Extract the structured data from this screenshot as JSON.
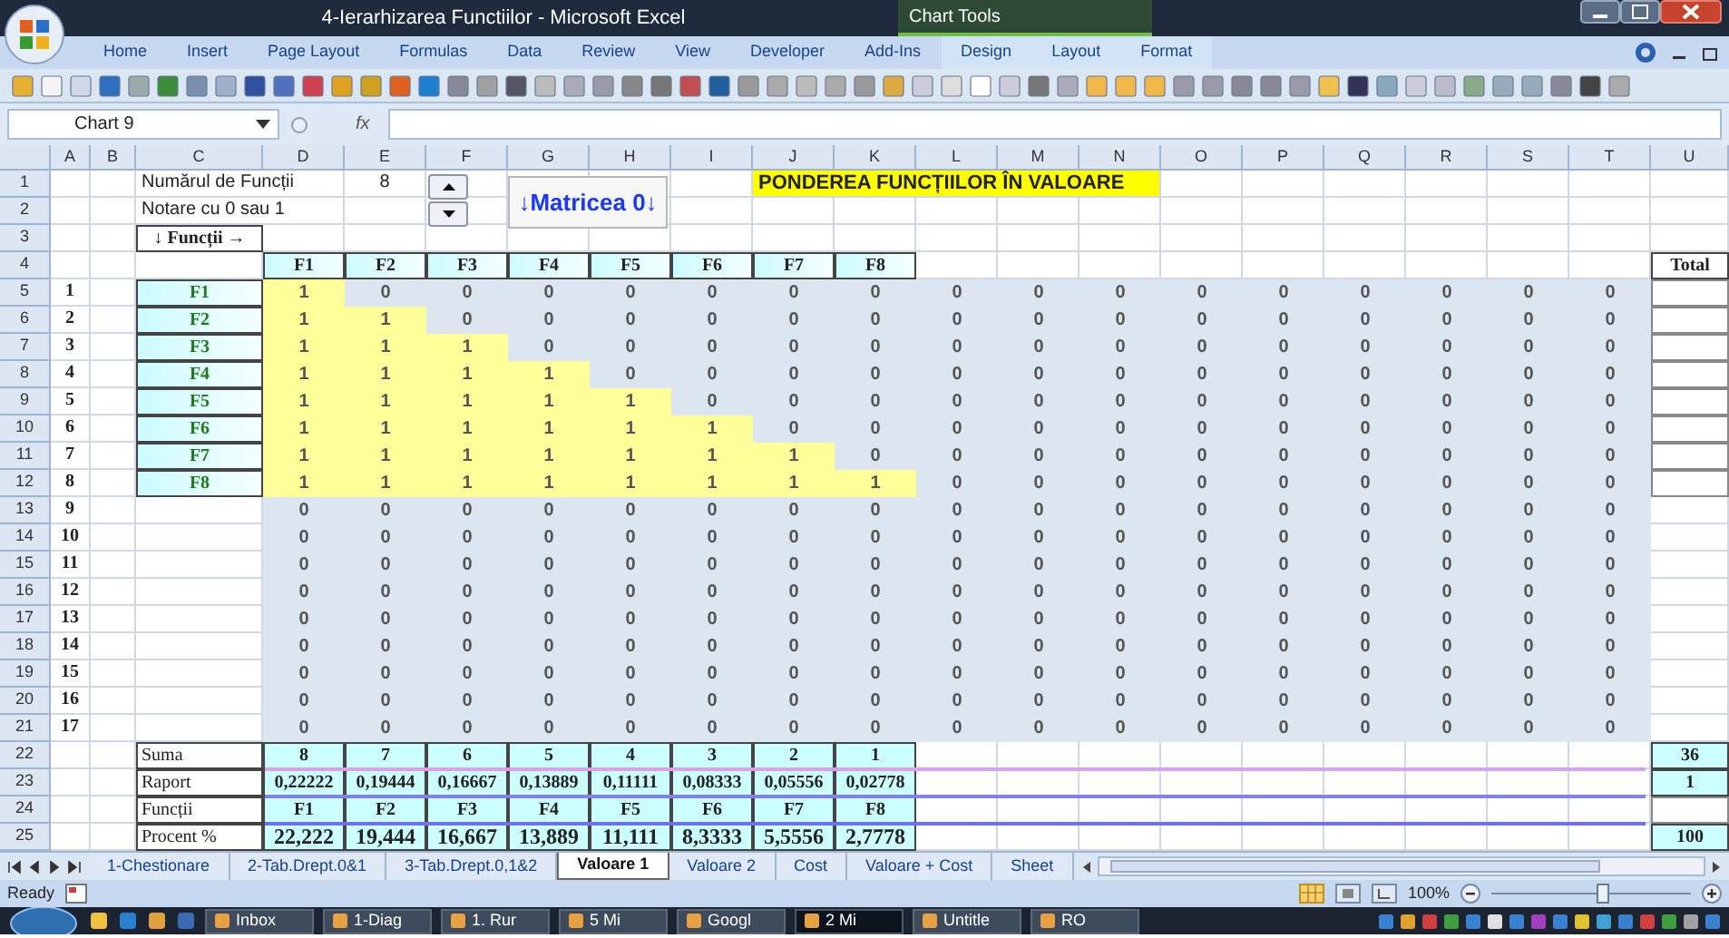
{
  "window": {
    "title": "4-Ierarhizarea Functiilor - Microsoft Excel",
    "context_label": "Chart Tools"
  },
  "ribbon_tabs": [
    {
      "label": "Home",
      "contextual": false
    },
    {
      "label": "Insert",
      "contextual": false
    },
    {
      "label": "Page Layout",
      "contextual": false
    },
    {
      "label": "Formulas",
      "contextual": false
    },
    {
      "label": "Data",
      "contextual": false
    },
    {
      "label": "Review",
      "contextual": false
    },
    {
      "label": "View",
      "contextual": false
    },
    {
      "label": "Developer",
      "contextual": false
    },
    {
      "label": "Add-Ins",
      "contextual": false
    },
    {
      "label": "Design",
      "contextual": true
    },
    {
      "label": "Layout",
      "contextual": true
    },
    {
      "label": "Format",
      "contextual": true
    }
  ],
  "formula_bar": {
    "name_box": "Chart 9",
    "function_label": "fx"
  },
  "columns": [
    "A",
    "B",
    "C",
    "D",
    "E",
    "F",
    "G",
    "H",
    "I",
    "J",
    "K",
    "L",
    "M",
    "N",
    "O",
    "P",
    "Q",
    "R",
    "S",
    "T",
    "U"
  ],
  "row_numbers": [
    "1",
    "2",
    "3",
    "4",
    "5",
    "6",
    "7",
    "8",
    "9",
    "10",
    "11",
    "12",
    "13",
    "14",
    "15",
    "16",
    "17",
    "18",
    "19",
    "20",
    "21",
    "22",
    "23",
    "24",
    "25"
  ],
  "header_block": {
    "count_label": "Numărul de Funcții",
    "count_value": "8",
    "note": "Notare cu 0 sau 1",
    "axis_label": "↓ Funcții →",
    "heading": "PONDEREA FUNCȚIILOR ÎN VALOARE"
  },
  "matrix_button": "↓Matricea 0↓",
  "matrix": {
    "column_labels": [
      "F1",
      "F2",
      "F3",
      "F4",
      "F5",
      "F6",
      "F7",
      "F8"
    ],
    "total_label": "Total",
    "rows": [
      {
        "number": "1",
        "label": "F1",
        "values": [
          "1",
          "0",
          "0",
          "0",
          "0",
          "0",
          "0",
          "0",
          "0",
          "0",
          "0",
          "0",
          "0",
          "0",
          "0",
          "0",
          "0"
        ],
        "highlighted": [
          true,
          false,
          false,
          false,
          false,
          false,
          false,
          false,
          false,
          false,
          false,
          false,
          false,
          false,
          false,
          false,
          false
        ]
      },
      {
        "number": "2",
        "label": "F2",
        "values": [
          "1",
          "1",
          "0",
          "0",
          "0",
          "0",
          "0",
          "0",
          "0",
          "0",
          "0",
          "0",
          "0",
          "0",
          "0",
          "0",
          "0"
        ],
        "highlighted": [
          true,
          true,
          false,
          false,
          false,
          false,
          false,
          false,
          false,
          false,
          false,
          false,
          false,
          false,
          false,
          false,
          false
        ]
      },
      {
        "number": "3",
        "label": "F3",
        "values": [
          "1",
          "1",
          "1",
          "0",
          "0",
          "0",
          "0",
          "0",
          "0",
          "0",
          "0",
          "0",
          "0",
          "0",
          "0",
          "0",
          "0"
        ],
        "highlighted": [
          true,
          true,
          true,
          false,
          false,
          false,
          false,
          false,
          false,
          false,
          false,
          false,
          false,
          false,
          false,
          false,
          false
        ]
      },
      {
        "number": "4",
        "label": "F4",
        "values": [
          "1",
          "1",
          "1",
          "1",
          "0",
          "0",
          "0",
          "0",
          "0",
          "0",
          "0",
          "0",
          "0",
          "0",
          "0",
          "0",
          "0"
        ],
        "highlighted": [
          true,
          true,
          true,
          true,
          false,
          false,
          false,
          false,
          false,
          false,
          false,
          false,
          false,
          false,
          false,
          false,
          false
        ]
      },
      {
        "number": "5",
        "label": "F5",
        "values": [
          "1",
          "1",
          "1",
          "1",
          "1",
          "0",
          "0",
          "0",
          "0",
          "0",
          "0",
          "0",
          "0",
          "0",
          "0",
          "0",
          "0"
        ],
        "highlighted": [
          true,
          true,
          true,
          true,
          true,
          false,
          false,
          false,
          false,
          false,
          false,
          false,
          false,
          false,
          false,
          false,
          false
        ]
      },
      {
        "number": "6",
        "label": "F6",
        "values": [
          "1",
          "1",
          "1",
          "1",
          "1",
          "1",
          "0",
          "0",
          "0",
          "0",
          "0",
          "0",
          "0",
          "0",
          "0",
          "0",
          "0"
        ],
        "highlighted": [
          true,
          true,
          true,
          true,
          true,
          true,
          false,
          false,
          false,
          false,
          false,
          false,
          false,
          false,
          false,
          false,
          false
        ]
      },
      {
        "number": "7",
        "label": "F7",
        "values": [
          "1",
          "1",
          "1",
          "1",
          "1",
          "1",
          "1",
          "0",
          "0",
          "0",
          "0",
          "0",
          "0",
          "0",
          "0",
          "0",
          "0"
        ],
        "highlighted": [
          true,
          true,
          true,
          true,
          true,
          true,
          true,
          false,
          false,
          false,
          false,
          false,
          false,
          false,
          false,
          false,
          false
        ]
      },
      {
        "number": "8",
        "label": "F8",
        "values": [
          "1",
          "1",
          "1",
          "1",
          "1",
          "1",
          "1",
          "1",
          "0",
          "0",
          "0",
          "0",
          "0",
          "0",
          "0",
          "0",
          "0"
        ],
        "highlighted": [
          true,
          true,
          true,
          true,
          true,
          true,
          true,
          true,
          false,
          false,
          false,
          false,
          false,
          false,
          false,
          false,
          false
        ]
      },
      {
        "number": "9",
        "values": [
          "0",
          "0",
          "0",
          "0",
          "0",
          "0",
          "0",
          "0",
          "0",
          "0",
          "0",
          "0",
          "0",
          "0",
          "0",
          "0",
          "0"
        ],
        "highlighted": [
          false,
          false,
          false,
          false,
          false,
          false,
          false,
          false,
          false,
          false,
          false,
          false,
          false,
          false,
          false,
          false,
          false
        ]
      },
      {
        "number": "10",
        "values": [
          "0",
          "0",
          "0",
          "0",
          "0",
          "0",
          "0",
          "0",
          "0",
          "0",
          "0",
          "0",
          "0",
          "0",
          "0",
          "0",
          "0"
        ],
        "highlighted": [
          false,
          false,
          false,
          false,
          false,
          false,
          false,
          false,
          false,
          false,
          false,
          false,
          false,
          false,
          false,
          false,
          false
        ]
      },
      {
        "number": "11",
        "values": [
          "0",
          "0",
          "0",
          "0",
          "0",
          "0",
          "0",
          "0",
          "0",
          "0",
          "0",
          "0",
          "0",
          "0",
          "0",
          "0",
          "0"
        ],
        "highlighted": [
          false,
          false,
          false,
          false,
          false,
          false,
          false,
          false,
          false,
          false,
          false,
          false,
          false,
          false,
          false,
          false,
          false
        ]
      },
      {
        "number": "12",
        "values": [
          "0",
          "0",
          "0",
          "0",
          "0",
          "0",
          "0",
          "0",
          "0",
          "0",
          "0",
          "0",
          "0",
          "0",
          "0",
          "0",
          "0"
        ],
        "highlighted": [
          false,
          false,
          false,
          false,
          false,
          false,
          false,
          false,
          false,
          false,
          false,
          false,
          false,
          false,
          false,
          false,
          false
        ]
      },
      {
        "number": "13",
        "values": [
          "0",
          "0",
          "0",
          "0",
          "0",
          "0",
          "0",
          "0",
          "0",
          "0",
          "0",
          "0",
          "0",
          "0",
          "0",
          "0",
          "0"
        ],
        "highlighted": [
          false,
          false,
          false,
          false,
          false,
          false,
          false,
          false,
          false,
          false,
          false,
          false,
          false,
          false,
          false,
          false,
          false
        ]
      },
      {
        "number": "14",
        "values": [
          "0",
          "0",
          "0",
          "0",
          "0",
          "0",
          "0",
          "0",
          "0",
          "0",
          "0",
          "0",
          "0",
          "0",
          "0",
          "0",
          "0"
        ],
        "highlighted": [
          false,
          false,
          false,
          false,
          false,
          false,
          false,
          false,
          false,
          false,
          false,
          false,
          false,
          false,
          false,
          false,
          false
        ]
      },
      {
        "number": "15",
        "values": [
          "0",
          "0",
          "0",
          "0",
          "0",
          "0",
          "0",
          "0",
          "0",
          "0",
          "0",
          "0",
          "0",
          "0",
          "0",
          "0",
          "0"
        ],
        "highlighted": [
          false,
          false,
          false,
          false,
          false,
          false,
          false,
          false,
          false,
          false,
          false,
          false,
          false,
          false,
          false,
          false,
          false
        ]
      },
      {
        "number": "16",
        "values": [
          "0",
          "0",
          "0",
          "0",
          "0",
          "0",
          "0",
          "0",
          "0",
          "0",
          "0",
          "0",
          "0",
          "0",
          "0",
          "0",
          "0"
        ],
        "highlighted": [
          false,
          false,
          false,
          false,
          false,
          false,
          false,
          false,
          false,
          false,
          false,
          false,
          false,
          false,
          false,
          false,
          false
        ]
      },
      {
        "number": "17",
        "values": [
          "0",
          "0",
          "0",
          "0",
          "0",
          "0",
          "0",
          "0",
          "0",
          "0",
          "0",
          "0",
          "0",
          "0",
          "0",
          "0",
          "0"
        ],
        "highlighted": [
          false,
          false,
          false,
          false,
          false,
          false,
          false,
          false,
          false,
          false,
          false,
          false,
          false,
          false,
          false,
          false,
          false
        ]
      }
    ]
  },
  "summary": [
    {
      "label": "Suma",
      "values": [
        "8",
        "7",
        "6",
        "5",
        "4",
        "3",
        "2",
        "1"
      ],
      "total": "36",
      "large": false
    },
    {
      "label": "Raport",
      "values": [
        "0,22222",
        "0,19444",
        "0,16667",
        "0,13889",
        "0,11111",
        "0,08333",
        "0,05556",
        "0,02778"
      ],
      "total": "1",
      "large": false
    },
    {
      "label": "Funcții",
      "values": [
        "F1",
        "F2",
        "F3",
        "F4",
        "F5",
        "F6",
        "F7",
        "F8"
      ],
      "large": false
    },
    {
      "label": "Procent %",
      "values": [
        "22,222",
        "19,444",
        "16,667",
        "13,889",
        "11,111",
        "8,3333",
        "5,5556",
        "2,7778"
      ],
      "total": "100",
      "large": true
    }
  ],
  "sheet_tabs": [
    {
      "label": "1-Chestionare",
      "selected": false
    },
    {
      "label": "2-Tab.Drept.0&1",
      "selected": false
    },
    {
      "label": "3-Tab.Drept.0,1&2",
      "selected": false
    },
    {
      "label": "Valoare 1",
      "selected": true
    },
    {
      "label": "Valoare 2",
      "selected": false
    },
    {
      "label": "Cost",
      "selected": false
    },
    {
      "label": "Valoare + Cost",
      "selected": false
    },
    {
      "label": "Sheet",
      "selected": false
    }
  ],
  "status_bar": {
    "text": "Ready",
    "zoom": "100%",
    "zoom_slider": {
      "level": 0.55
    }
  },
  "taskbar": [
    {
      "label": "Inbox",
      "selected": false
    },
    {
      "label": "1-Diag",
      "selected": false
    },
    {
      "label": "1. Rur",
      "selected": false
    },
    {
      "label": "5 Mi",
      "selected": false
    },
    {
      "label": "Googl",
      "selected": false
    },
    {
      "label": "2 Mi",
      "selected": true
    },
    {
      "label": "Untitle",
      "selected": false
    },
    {
      "label": "RO",
      "selected": false
    }
  ]
}
